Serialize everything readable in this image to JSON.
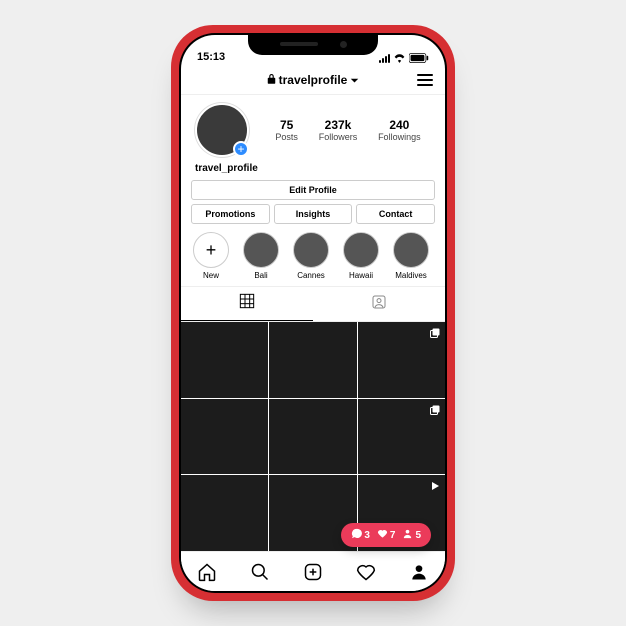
{
  "status": {
    "time": "15:13"
  },
  "header": {
    "username_title": "travelprofile"
  },
  "profile": {
    "username": "travel_profile",
    "stats": {
      "posts": {
        "value": "75",
        "label": "Posts"
      },
      "followers": {
        "value": "237k",
        "label": "Followers"
      },
      "followings": {
        "value": "240",
        "label": "Followings"
      }
    }
  },
  "buttons": {
    "edit": "Edit Profile",
    "promotions": "Promotions",
    "insights": "Insights",
    "contact": "Contact"
  },
  "highlights": [
    {
      "label": "New"
    },
    {
      "label": "Bali"
    },
    {
      "label": "Cannes"
    },
    {
      "label": "Hawaii"
    },
    {
      "label": "Maldives"
    }
  ],
  "notification": {
    "comments": "3",
    "likes": "7",
    "followers": "5"
  }
}
